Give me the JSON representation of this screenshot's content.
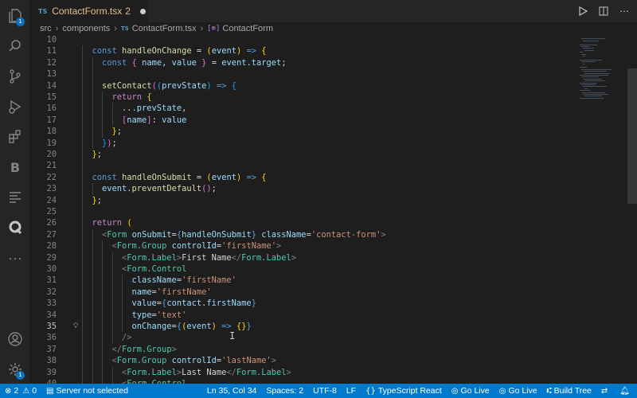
{
  "tab": {
    "lang": "TS",
    "file": "ContactForm.tsx",
    "problems": "2"
  },
  "breadcrumb": {
    "src": "src",
    "components": "components",
    "lang": "TS",
    "file": "ContactForm.tsx",
    "symbol_icon": "[⊚]",
    "symbol": "ContactForm"
  },
  "editor": {
    "lines": [
      {
        "n": "10",
        "indent": 0,
        "html": ""
      },
      {
        "n": "11",
        "indent": 1,
        "html": "<span class=\"k\">const</span> <span class=\"fn\">handleOnChange</span> = <span class=\"yb\">(</span><span class=\"v\">event</span><span class=\"yb\">)</span> <span class=\"k\">=&gt;</span> <span class=\"yb\">{</span>"
      },
      {
        "n": "12",
        "indent": 2,
        "html": "<span class=\"k\">const</span> <span class=\"pb\">{</span> <span class=\"v\">name</span>, <span class=\"v\">value</span> <span class=\"pb\">}</span> = <span class=\"v\">event</span>.<span class=\"v\">target</span>;"
      },
      {
        "n": "13",
        "indent": 2,
        "html": ""
      },
      {
        "n": "14",
        "indent": 2,
        "html": "<span class=\"fn\">setContact</span><span class=\"pb\">(</span><span class=\"bb\">(</span><span class=\"v\">prevState</span><span class=\"bb\">)</span> <span class=\"k\">=&gt;</span> <span class=\"bb\">{</span>"
      },
      {
        "n": "15",
        "indent": 3,
        "html": "<span class=\"kc\">return</span> <span class=\"yb\">{</span>"
      },
      {
        "n": "16",
        "indent": 4,
        "html": "...<span class=\"v\">prevState</span>,"
      },
      {
        "n": "17",
        "indent": 4,
        "html": "<span class=\"pb\">[</span><span class=\"v\">name</span><span class=\"pb\">]</span>: <span class=\"v\">value</span>"
      },
      {
        "n": "18",
        "indent": 3,
        "html": "<span class=\"yb\">}</span>;"
      },
      {
        "n": "19",
        "indent": 2,
        "html": "<span class=\"bb\">}</span><span class=\"pb\">)</span>;"
      },
      {
        "n": "20",
        "indent": 1,
        "html": "<span class=\"yb\">}</span>;"
      },
      {
        "n": "21",
        "indent": 1,
        "html": ""
      },
      {
        "n": "22",
        "indent": 1,
        "html": "<span class=\"k\">const</span> <span class=\"fn\">handleOnSubmit</span> = <span class=\"yb\">(</span><span class=\"v\">event</span><span class=\"yb\">)</span> <span class=\"k\">=&gt;</span> <span class=\"yb\">{</span>"
      },
      {
        "n": "23",
        "indent": 2,
        "html": "<span class=\"v\">event</span>.<span class=\"fn\">preventDefault</span><span class=\"pb\">()</span>;"
      },
      {
        "n": "24",
        "indent": 1,
        "html": "<span class=\"yb\">}</span>;"
      },
      {
        "n": "25",
        "indent": 1,
        "html": ""
      },
      {
        "n": "26",
        "indent": 1,
        "html": "<span class=\"kc\">return</span> <span class=\"yb\">(</span>"
      },
      {
        "n": "27",
        "indent": 2,
        "html": "<span class=\"tg\">&lt;</span><span class=\"t\">Form</span> <span class=\"v\">onSubmit</span>=<span class=\"k\">{</span><span class=\"v\">handleOnSubmit</span><span class=\"k\">}</span> <span class=\"v\">className</span>=<span class=\"s\">'contact-form'</span><span class=\"tg\">&gt;</span>"
      },
      {
        "n": "28",
        "indent": 3,
        "html": "<span class=\"tg\">&lt;</span><span class=\"t\">Form.Group</span> <span class=\"v\">controlId</span>=<span class=\"s\">'firstName'</span><span class=\"tg\">&gt;</span>"
      },
      {
        "n": "29",
        "indent": 4,
        "html": "<span class=\"tg\">&lt;</span><span class=\"t\">Form.Label</span><span class=\"tg\">&gt;</span>First Name<span class=\"tg\">&lt;/</span><span class=\"t\">Form.Label</span><span class=\"tg\">&gt;</span>"
      },
      {
        "n": "30",
        "indent": 4,
        "html": "<span class=\"tg\">&lt;</span><span class=\"t\">Form.Control</span>"
      },
      {
        "n": "31",
        "indent": 5,
        "html": "<span class=\"v\">className</span>=<span class=\"s\">'firstName'</span>"
      },
      {
        "n": "32",
        "indent": 5,
        "html": "<span class=\"v\">name</span>=<span class=\"s\">'firstName'</span>"
      },
      {
        "n": "33",
        "indent": 5,
        "html": "<span class=\"v\">value</span>=<span class=\"k\">{</span><span class=\"v\">contact</span>.<span class=\"v\">firstName</span><span class=\"k\">}</span>"
      },
      {
        "n": "34",
        "indent": 5,
        "html": "<span class=\"v\">type</span>=<span class=\"s\">'text'</span>"
      },
      {
        "n": "35",
        "indent": 5,
        "html": "<span class=\"v\">onChange</span>=<span class=\"k\">{</span><span class=\"yb\">(</span><span class=\"v\">event</span><span class=\"yb\">)</span> <span class=\"k\">=&gt;</span> <span class=\"yb\">{}</span><span class=\"k\">}</span>"
      },
      {
        "n": "36",
        "indent": 4,
        "html": "<span class=\"tg\">/&gt;</span>"
      },
      {
        "n": "37",
        "indent": 3,
        "html": "<span class=\"tg\">&lt;/</span><span class=\"t\">Form.Group</span><span class=\"tg\">&gt;</span>"
      },
      {
        "n": "38",
        "indent": 3,
        "html": "<span class=\"tg\">&lt;</span><span class=\"t\">Form.Group</span> <span class=\"v\">controlId</span>=<span class=\"s\">'lastName'</span><span class=\"tg\">&gt;</span>"
      },
      {
        "n": "39",
        "indent": 4,
        "html": "<span class=\"tg\">&lt;</span><span class=\"t\">Form.Label</span><span class=\"tg\">&gt;</span>Last Name<span class=\"tg\">&lt;/</span><span class=\"t\">Form.Label</span><span class=\"tg\">&gt;</span>"
      },
      {
        "n": "40",
        "indent": 4,
        "html": "<span class=\"tg\">&lt;</span><span class=\"t\">Form.Control</span>"
      }
    ],
    "active_line": "35"
  },
  "activity": {
    "explorer_badge": "1",
    "settings_badge": "1",
    "b_label": "B",
    "more": "···"
  },
  "status": {
    "errors": "2",
    "warnings": "0",
    "server": "Server not selected",
    "position": "Ln 35, Col 34",
    "spaces": "Spaces: 2",
    "encoding": "UTF-8",
    "eol": "LF",
    "language": "TypeScript React",
    "golive1": "Go Live",
    "golive2": "Go Live",
    "build": "Build Tree"
  },
  "colors": {
    "statusbar": "#007acc",
    "editor_bg": "#1e1e1e",
    "accent_badge": "#0e70c0"
  }
}
